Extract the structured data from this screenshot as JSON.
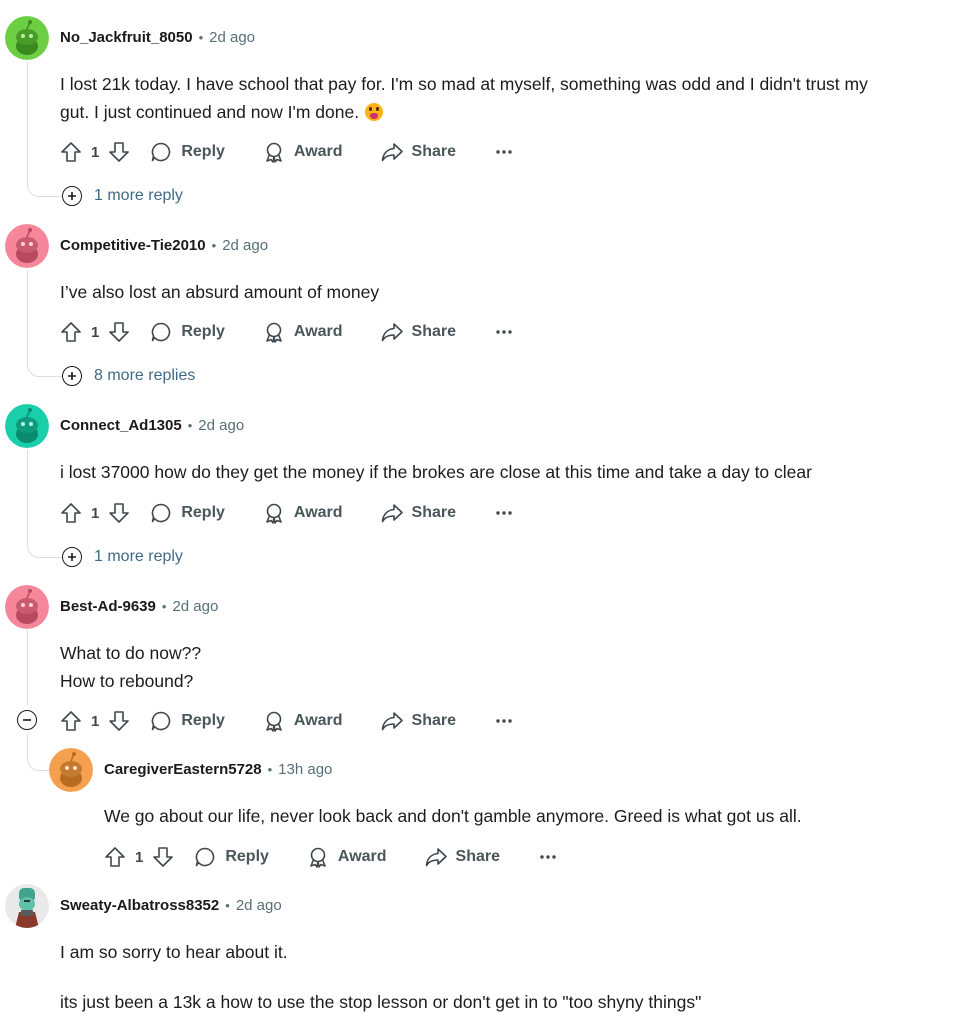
{
  "comments": [
    {
      "author": "No_Jackfruit_8050",
      "time": "2d ago",
      "avatar_color": "#6ccf43",
      "body": [
        "I lost 21k today. I have school that pay for. I'm so mad at myself, something was odd and I didn't trust my",
        "gut. I just continued and now I'm done."
      ],
      "emoji_icon": "face-screaming-emoji",
      "score": "1",
      "more": "1 more reply"
    },
    {
      "author": "Competitive-Tie2010",
      "time": "2d ago",
      "avatar_color": "#f6879a",
      "body": [
        "I’ve also lost an absurd amount of money"
      ],
      "score": "1",
      "more": "8 more replies"
    },
    {
      "author": "Connect_Ad1305",
      "time": "2d ago",
      "avatar_color": "#18cfa9",
      "body": [
        "i lost 37000 how do they get the money if the brokes are close at this time and take a day to clear"
      ],
      "score": "1",
      "more": "1 more reply"
    },
    {
      "author": "Best-Ad-9639",
      "time": "2d ago",
      "avatar_color": "#f6879a",
      "body": [
        "What to do now??",
        "How to rebound?"
      ],
      "score": "1"
    },
    {
      "author": "CaregiverEastern5728",
      "time": "13h ago",
      "avatar_color": "#f5a04f",
      "body": [
        "We go about our life, never look back and don't gamble anymore. Greed is what got us all."
      ],
      "score": "1"
    },
    {
      "author": "Sweaty-Albatross8352",
      "time": "2d ago",
      "avatar_color": "#e9e9e9",
      "body": [
        "I am so sorry to hear about it.",
        "its just been a 13k a how to use the stop lesson or don't get in to \"too shyny things\""
      ]
    }
  ],
  "actions": {
    "reply": "Reply",
    "award": "Award",
    "share": "Share",
    "overflow_icon": "ellipsis-icon"
  },
  "separator": "•"
}
